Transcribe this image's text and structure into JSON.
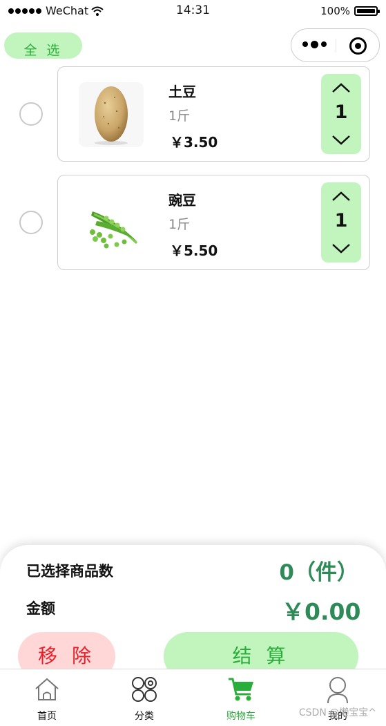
{
  "status_bar": {
    "carrier": "WeChat",
    "time": "14:31",
    "battery": "100%"
  },
  "header": {
    "select_all_label": "全 选"
  },
  "cart_items": [
    {
      "name": "土豆",
      "unit": "1斤",
      "price": "￥3.50",
      "quantity": "1",
      "image": "potato"
    },
    {
      "name": "豌豆",
      "unit": "1斤",
      "price": "￥5.50",
      "quantity": "1",
      "image": "peas"
    }
  ],
  "summary": {
    "selected_count_label": "已选择商品数",
    "selected_count_value": "0（件）",
    "amount_label": "金额",
    "amount_value": "￥0.00",
    "remove_label": "移 除",
    "checkout_label": "结 算"
  },
  "tabbar": {
    "tabs": [
      {
        "label": "首页",
        "icon": "home-icon"
      },
      {
        "label": "分类",
        "icon": "category-icon"
      },
      {
        "label": "购物车",
        "icon": "cart-icon",
        "active": true
      },
      {
        "label": "我的",
        "icon": "user-icon"
      }
    ]
  },
  "watermark": "CSDN @懒宝宝^"
}
